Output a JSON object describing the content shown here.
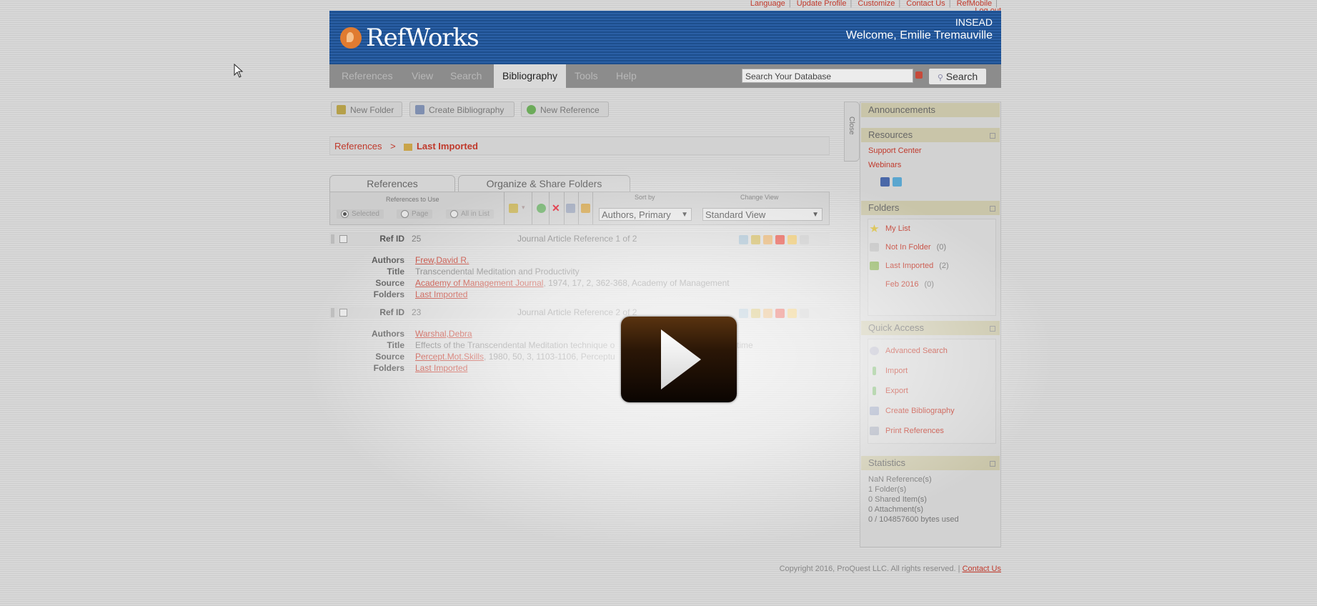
{
  "top_links": [
    "Language",
    "Update Profile",
    "Customize",
    "Contact Us",
    "RefMobile",
    "Log out"
  ],
  "header": {
    "logo_text": "RefWorks",
    "institution": "INSEAD",
    "welcome": "Welcome, Emilie Tremauville"
  },
  "nav": {
    "tabs": [
      "References",
      "View",
      "Search",
      "Bibliography",
      "Tools",
      "Help"
    ],
    "active_tab": "Bibliography",
    "search_placeholder": "Search Your Database",
    "search_button": "Search"
  },
  "toolbar": {
    "new_folder": "New Folder",
    "create_bibliography": "Create Bibliography",
    "new_reference": "New Reference"
  },
  "breadcrumb": {
    "root": "References",
    "separator": ">",
    "current": "Last Imported"
  },
  "tabs": {
    "references": "References",
    "organize": "Organize & Share Folders"
  },
  "controls": {
    "refs_to_use_label": "References to Use",
    "opt_selected": "Selected",
    "opt_page": "Page",
    "opt_all": "All in List",
    "sort_by_label": "Sort by",
    "sort_value": "Authors, Primary",
    "change_view_label": "Change View",
    "view_value": "Standard View"
  },
  "field_labels": {
    "ref_id": "Ref ID",
    "authors": "Authors",
    "title": "Title",
    "source": "Source",
    "folders": "Folders"
  },
  "references": [
    {
      "ref_id": "25",
      "type": "Journal Article Reference 1 of 2",
      "authors": "Frew,David R.",
      "title": "Transcendental Meditation and Productivity",
      "source_link": "Academy of Management Journal",
      "source_rest": ", 1974, 17, 2, 362-368, Academy of Management",
      "folder": "Last Imported"
    },
    {
      "ref_id": "23",
      "type": "Journal Article Reference 2 of 2",
      "authors": "Warshal,Debra",
      "title_left": "Effects of the Transcendental Meditation technique o",
      "title_right": "time",
      "source_link": "Percept.Mot.Skills",
      "source_rest": ", 1980, 50, 3, 1103-1106, Perceptu",
      "folder": "Last Imported"
    }
  ],
  "sidebar": {
    "close_label": "Close",
    "announcements": "Announcements",
    "resources": {
      "title": "Resources",
      "links": [
        "Support Center",
        "Webinars"
      ]
    },
    "folders": {
      "title": "Folders",
      "items": [
        {
          "label": "My List",
          "count": ""
        },
        {
          "label": "Not In Folder",
          "count": "(0)"
        },
        {
          "label": "Last Imported",
          "count": "(2)"
        },
        {
          "label": "Feb 2016",
          "count": "(0)"
        }
      ]
    },
    "quick_access": {
      "title": "Quick Access",
      "items": [
        "Advanced Search",
        "Import",
        "Export",
        "Create Bibliography",
        "Print References"
      ]
    },
    "statistics": {
      "title": "Statistics",
      "lines": [
        "NaN Reference(s)",
        "1 Folder(s)",
        "0 Shared Item(s)",
        "0 Attachment(s)",
        "0 / 104857600 bytes used"
      ]
    }
  },
  "footer": {
    "copyright": "Copyright 2016, ProQuest LLC. All rights reserved. |",
    "contact": "Contact Us"
  },
  "colors": {
    "header_blue": "#1d4e8d",
    "link_red": "#c0392b",
    "play_brown": "#5a3310"
  },
  "icons": [
    "play-icon",
    "mouse-cursor-icon",
    "folder-icon",
    "facebook-icon",
    "twitter-icon"
  ]
}
